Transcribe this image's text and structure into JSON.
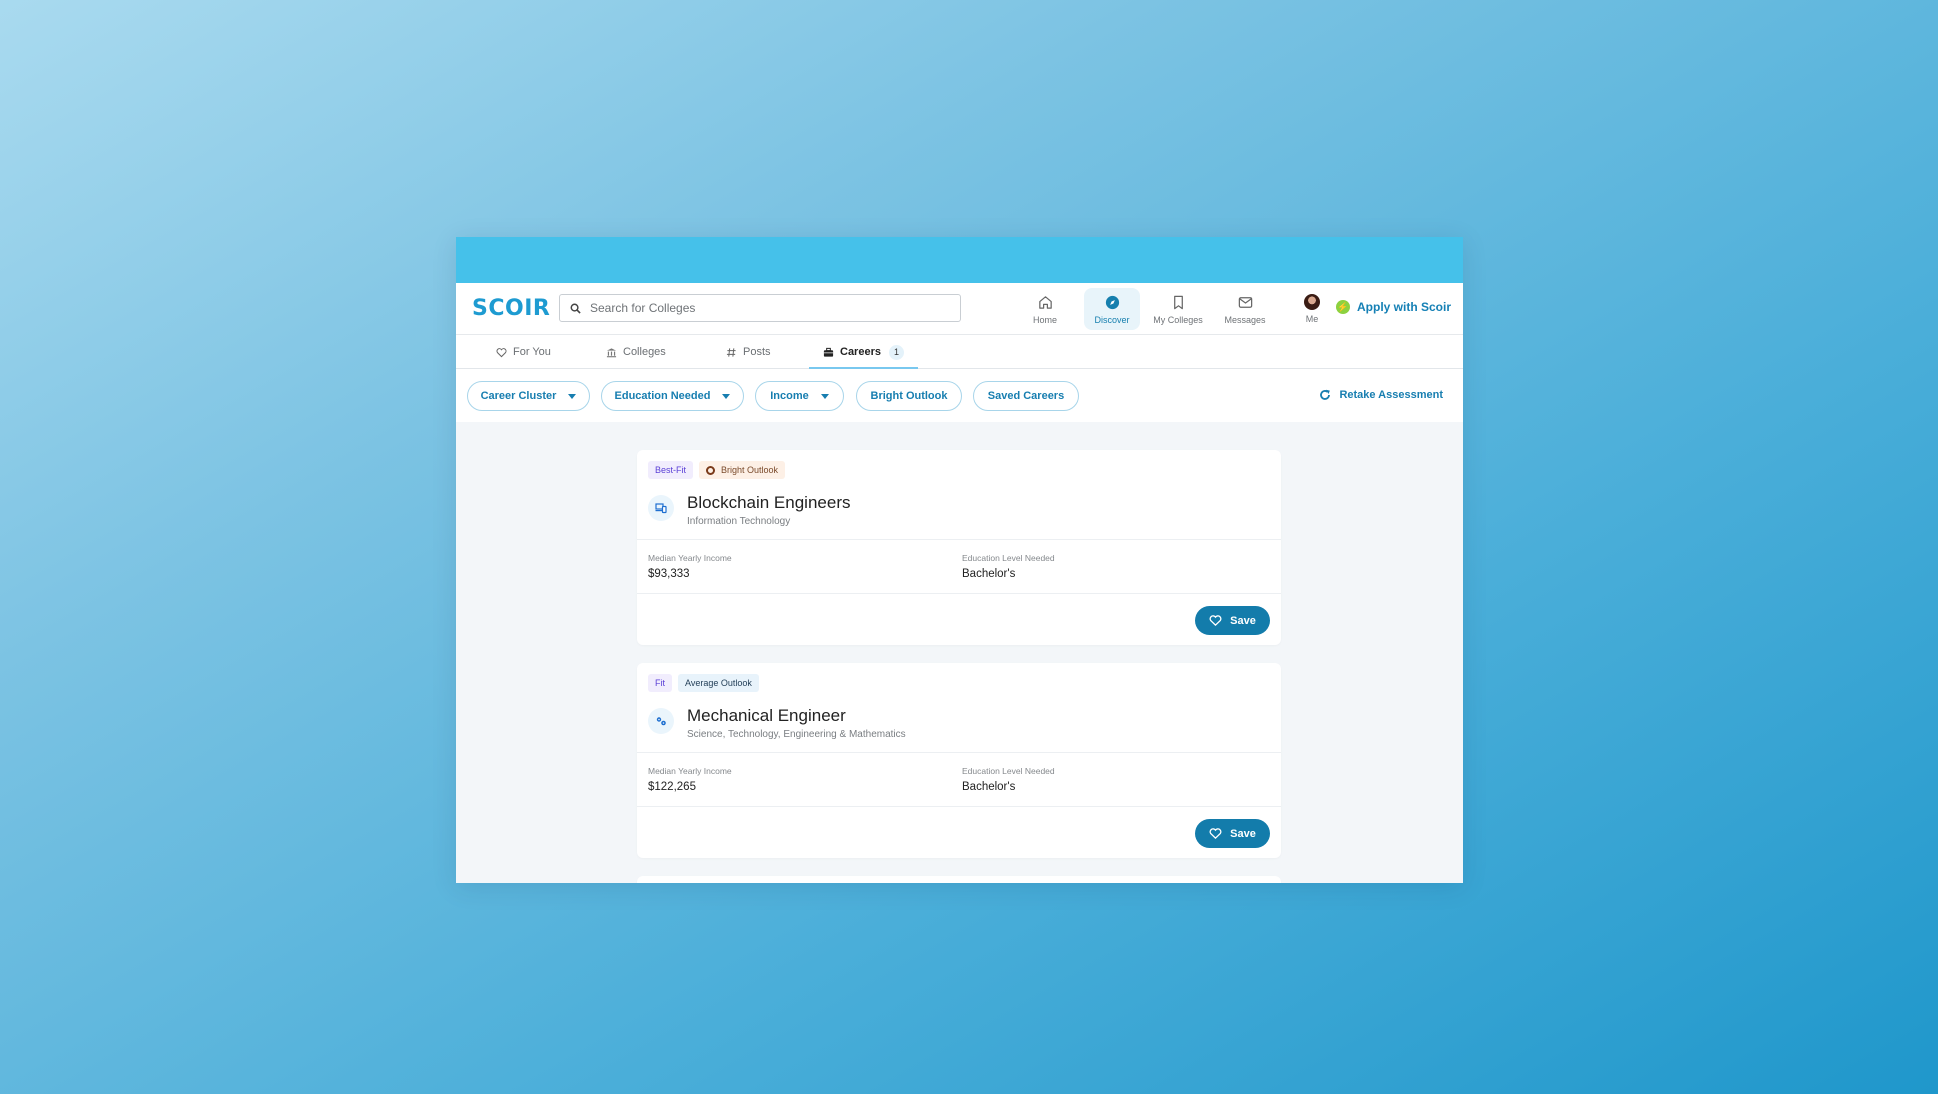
{
  "app": {
    "logo": "SCOIR",
    "search": {
      "placeholder": "Search for Colleges",
      "value": ""
    },
    "nav": [
      {
        "label": "Home",
        "icon": "home-icon",
        "active": false
      },
      {
        "label": "Discover",
        "icon": "compass-icon",
        "active": true
      },
      {
        "label": "My Colleges",
        "icon": "bookmark-icon",
        "active": false
      },
      {
        "label": "Messages",
        "icon": "envelope-icon",
        "active": false
      },
      {
        "label": "Me",
        "icon": "avatar",
        "active": false
      }
    ],
    "apply_label": "Apply with Scoir"
  },
  "tabs": [
    {
      "label": "For You",
      "icon": "heart-icon"
    },
    {
      "label": "Colleges",
      "icon": "institution-icon"
    },
    {
      "label": "Posts",
      "icon": "hashtag-icon"
    },
    {
      "label": "Careers",
      "icon": "briefcase-icon",
      "active": true,
      "badge": "1"
    }
  ],
  "filters": {
    "chips": [
      {
        "label": "Career Cluster",
        "dropdown": true
      },
      {
        "label": "Education Needed",
        "dropdown": true
      },
      {
        "label": "Income",
        "dropdown": true
      },
      {
        "label": "Bright Outlook",
        "dropdown": false
      },
      {
        "label": "Saved Careers",
        "dropdown": false
      }
    ],
    "retake_label": "Retake Assessment"
  },
  "careers": [
    {
      "fit": "Best-Fit",
      "outlook": "Bright Outlook",
      "title": "Blockchain Engineers",
      "cluster": "Information Technology",
      "income_label": "Median Yearly Income",
      "income": "$93,333",
      "education_label": "Education Level Needed",
      "education": "Bachelor's",
      "save_label": "Save"
    },
    {
      "fit": "Fit",
      "outlook": "Average Outlook",
      "title": "Mechanical Engineer",
      "cluster": "Science, Technology, Engineering & Mathematics",
      "income_label": "Median Yearly Income",
      "income": "$122,265",
      "education_label": "Education Level Needed",
      "education": "Bachelor's",
      "save_label": "Save"
    }
  ],
  "colors": {
    "brand": "#1e9bd1",
    "header_strip": "#45c1ea",
    "primary_button": "#137cab",
    "apply_bolt": "#8cd13f"
  }
}
